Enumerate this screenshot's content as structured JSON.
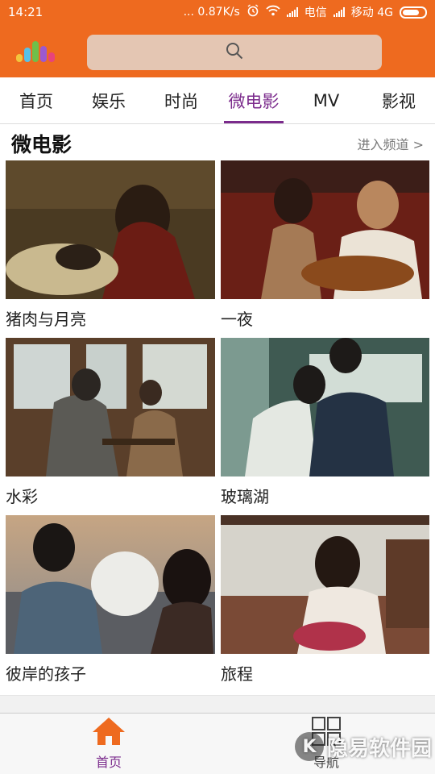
{
  "status_bar": {
    "time": "14:21",
    "net_speed": "... 0.87K/s",
    "carrier1": "电信",
    "carrier2": "移动 4G"
  },
  "search": {
    "icon": "search-icon"
  },
  "tabs": [
    {
      "label": "首页",
      "active": false
    },
    {
      "label": "娱乐",
      "active": false
    },
    {
      "label": "时尚",
      "active": false
    },
    {
      "label": "微电影",
      "active": true
    },
    {
      "label": "MV",
      "active": false
    },
    {
      "label": "影视",
      "active": false
    }
  ],
  "section": {
    "title": "微电影",
    "more": "进入频道 >"
  },
  "videos": [
    {
      "title": "猪肉与月亮"
    },
    {
      "title": "一夜"
    },
    {
      "title": "水彩"
    },
    {
      "title": "玻璃湖"
    },
    {
      "title": "彼岸的孩子"
    },
    {
      "title": "旅程"
    }
  ],
  "bottom_nav": {
    "home_label": "首页",
    "nav_label": "导航"
  },
  "watermark": {
    "text": "隐易软件园",
    "badge": "K"
  },
  "colors": {
    "brand_orange": "#ee6a1f",
    "accent_purple": "#7b2b8c"
  }
}
